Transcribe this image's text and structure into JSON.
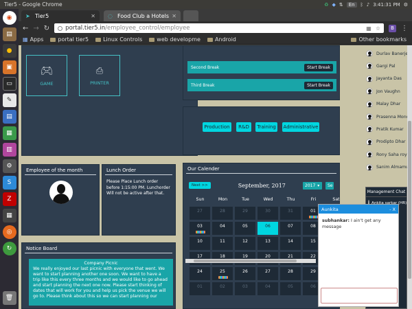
{
  "os": {
    "window_title": "Tier5 - Google Chrome",
    "keyboard": "En",
    "clock": "3:41:31 PM"
  },
  "browser": {
    "tabs": [
      {
        "label": "Tier5"
      },
      {
        "label": "Food Club a Hotels"
      }
    ],
    "url_host": "portal.tier5.in",
    "url_path": "/employee_control/employee",
    "bookmarks": [
      "Apps",
      "portal tier5",
      "Linux Controls",
      "web developme",
      "Android"
    ],
    "other_bookmarks": "Other bookmarks"
  },
  "tiles": [
    {
      "label": "GAME",
      "icon": "gamepad-icon"
    },
    {
      "label": "PRINTER",
      "icon": "printer-icon"
    }
  ],
  "breaks": [
    {
      "label": "Second Break",
      "button": "Start Break"
    },
    {
      "label": "Third Break",
      "button": "Start Break"
    }
  ],
  "departments": [
    "Production",
    "R&D",
    "Training",
    "Administrative"
  ],
  "employee_of_month": {
    "title": "Employee of the month"
  },
  "lunch_order": {
    "title": "Lunch Order",
    "text": "Please Place Lunch order before 1:15:00 PM. Lunchorder Will not be active after that."
  },
  "notice_board": {
    "title": "Notice Board",
    "heading": "Company Picnic",
    "text": "We really enjoyed our last picnic with everyone that went. We want to start planning another one soon. We want to have a trip like this every three months and we would like to go ahead and start planning the next one now. Please start thinking of dates that will work for you and help us pick the venue we will go to. Please think about this so we can start planning our"
  },
  "calendar": {
    "title": "Our Calender",
    "next_label": "Next >>",
    "month_label": "September, 2017",
    "year_select": "2017",
    "month_select": "Se",
    "weekdays": [
      "Sun",
      "Mon",
      "Tue",
      "Wed",
      "Thu",
      "Fri",
      "Sat"
    ],
    "weeks": [
      [
        "27",
        "28",
        "29",
        "30",
        "31",
        "01",
        "02"
      ],
      [
        "03",
        "04",
        "05",
        "06",
        "07",
        "08",
        "09"
      ],
      [
        "10",
        "11",
        "12",
        "13",
        "14",
        "15",
        "16"
      ],
      [
        "17",
        "18",
        "19",
        "20",
        "21",
        "22",
        "23"
      ],
      [
        "24",
        "25",
        "26",
        "27",
        "28",
        "29",
        "30"
      ],
      [
        "01",
        "02",
        "03",
        "04",
        "05",
        "06",
        "07"
      ]
    ],
    "today": "06"
  },
  "people": [
    "Durlav Banerjee",
    "Gargi Pal",
    "Jayanta Das",
    "Jon Vaughn",
    "Malay Dhar",
    "Prasenna Mondal",
    "Pratik Kumar",
    "Prodipto Dhar",
    "Rony Saha roy",
    "Sanim Almamun"
  ],
  "management_chat": {
    "title": "Management Chat",
    "members": [
      "Ankita sarkar (HR)"
    ]
  },
  "chat_window": {
    "name": "Aunkita",
    "controls": "- X",
    "sender": "subhankar:",
    "message": "I ain't get any message"
  }
}
